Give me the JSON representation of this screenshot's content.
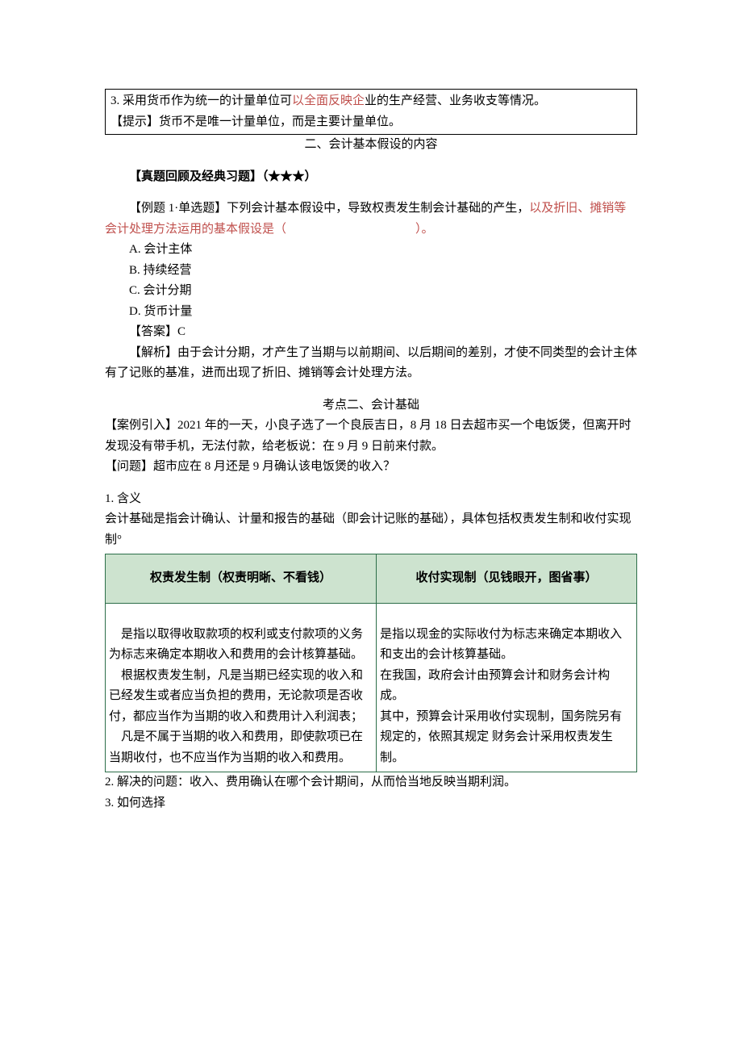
{
  "topBox": {
    "line1_a": "3. 采用货币作为统一的计量单位可",
    "line1_b": "以全面反映企",
    "line1_c": "业的生产经营、业务收支等情况。",
    "line2": "【提示】货币不是唯一计量单位，而是主要计量单位。"
  },
  "heading1": "二、会计基本假设的内容",
  "review_label": "【真题回顾及经典习题】（★★★）",
  "q1": {
    "stem_a": "【例题 1·单选题】下列会计基本假设中，导致权责发生制会计基础的产生，",
    "stem_b": "以及折旧、摊销等会计处理方法运用的基本假设是（",
    "stem_c": "）。",
    "optA": "A. 会计主体",
    "optB": "B. 持续经营",
    "optC": "C. 会计分期",
    "optD": "D. 货币计量",
    "ans": "【答案】C",
    "exp": "【解析】由于会计分期，才产生了当期与以前期间、以后期间的差别，才使不同类型的会计主体有了记账的基准，进而出现了折旧、摊销等会计处理方法。"
  },
  "kp2_title": "考点二、会计基础",
  "case_intro": "【案例引入】2021 年的一天，小良子选了一个良辰吉日，8 月 18 日去超市买一个电饭煲，但离开时发现没有带手机，无法付款，给老板说：在 9 月 9 日前来付款。",
  "question_line": "【问题】超市应在 8 月还是 9 月确认该电饭煲的收入？",
  "def_title": "1. 含义",
  "def_body_a": "会计基础是指会计确认、计量和报告的基础（即会计记账的基础），具体包括权责发生制和收付实现制",
  "def_body_b": "°",
  "table": {
    "h1": "权责发生制（权责明晰、不看钱）",
    "h2": "收付实现制（见钱眼开，图省事）",
    "left": "　是指以取得收取款项的权利或支付款项的义务为标志来确定本期收入和费用的会计核算基础。\n　根据权责发生制，凡是当期已经实现的收入和已经发生或者应当负担的费用，无论款项是否收付，都应当作为当期的收入和费用计入利润表；\n　凡是不属于当期的收入和费用，即使款项已在当期收付，也不应当作为当期的收入和费用。",
    "right": "是指以现金的实际收付为标志来确定本期收入和支出的会计核算基础。\n在我国，政府会计由预算会计和财务会计构成。\n其中，预算会计采用收付实现制，国务院另有规定的，依照其规定 财务会计采用权责发生制。"
  },
  "p2": "2. 解决的问题：收入、费用确认在哪个会计期间，从而恰当地反映当期利润。",
  "p3": "3. 如何选择"
}
